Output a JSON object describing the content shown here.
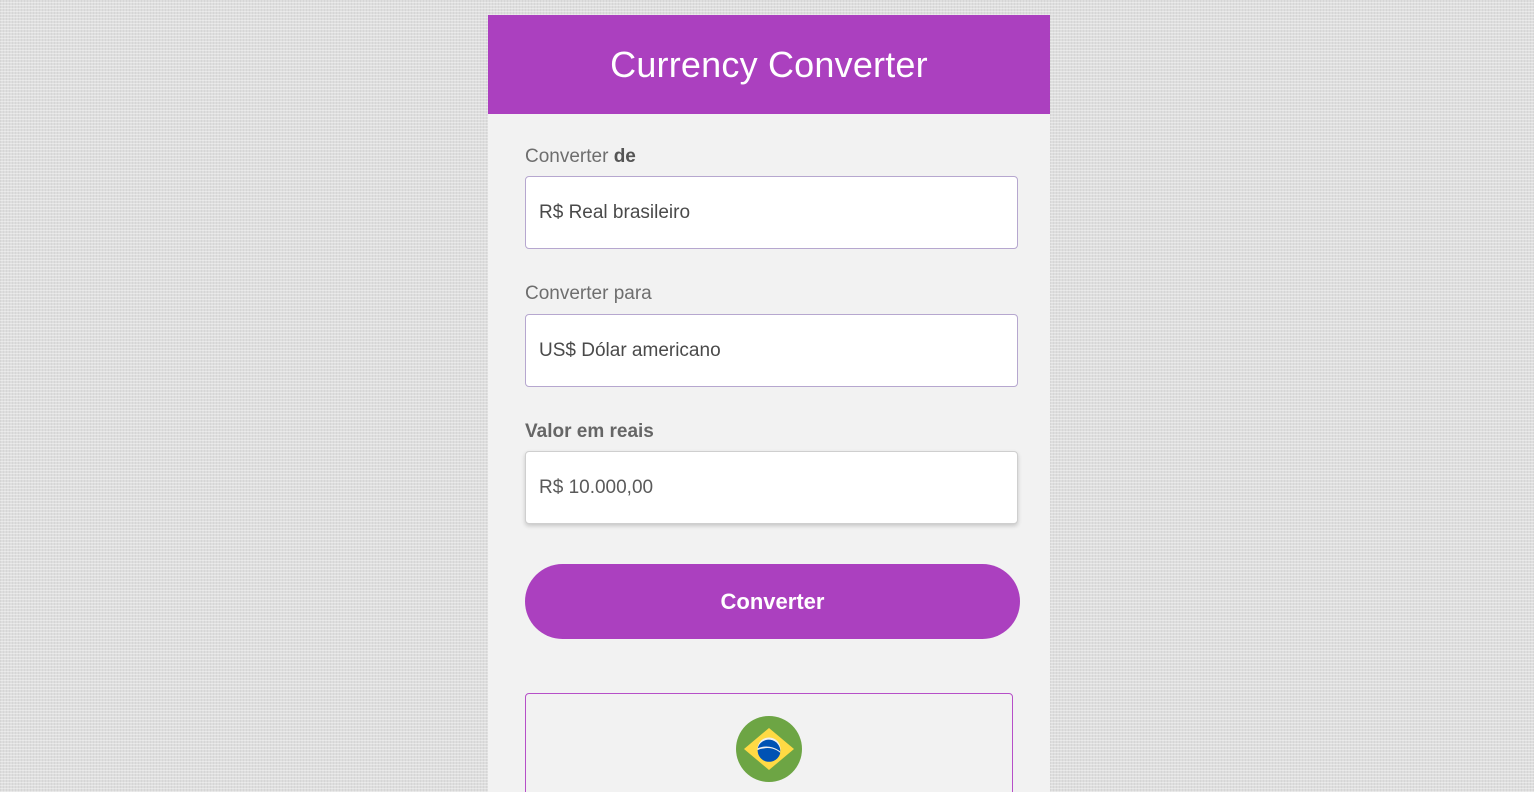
{
  "header": {
    "title": "Currency Converter"
  },
  "from": {
    "label_prefix": "Converter ",
    "label_bold": "de",
    "selected": "R$ Real brasileiro"
  },
  "to": {
    "label": "Converter para",
    "selected": "US$ Dólar americano"
  },
  "amount": {
    "label": "Valor em reais",
    "value": "R$ 10.000,00"
  },
  "actions": {
    "convert_label": "Converter"
  },
  "result": {
    "flag_icon": "brazil-flag-icon"
  },
  "colors": {
    "accent": "#ab40bf",
    "card_bg": "#f2f2f2",
    "page_bg": "#dedede"
  }
}
